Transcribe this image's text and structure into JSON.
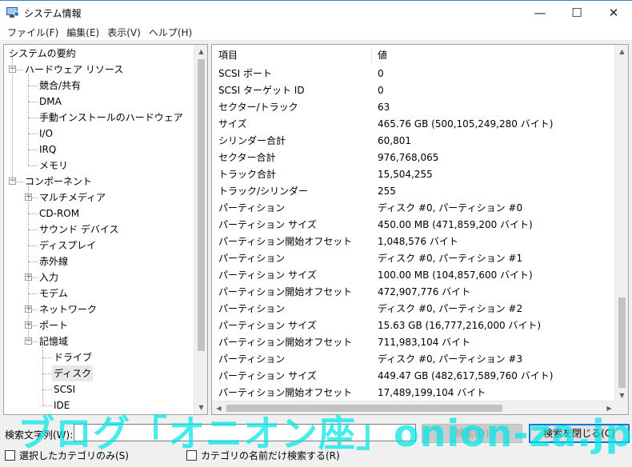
{
  "window": {
    "title": "システム情報",
    "controls": {
      "minimize": "—",
      "maximize": "☐",
      "close": "✕"
    }
  },
  "menu": [
    "ファイル(F)",
    "編集(E)",
    "表示(V)",
    "ヘルプ(H)"
  ],
  "tree": [
    {
      "label": "システムの要約",
      "level": 0,
      "expander": ""
    },
    {
      "label": "ハードウェア リソース",
      "level": 1,
      "expander": "−"
    },
    {
      "label": "競合/共有",
      "level": 2,
      "expander": ""
    },
    {
      "label": "DMA",
      "level": 2,
      "expander": ""
    },
    {
      "label": "手動インストールのハードウェア",
      "level": 2,
      "expander": ""
    },
    {
      "label": "I/O",
      "level": 2,
      "expander": ""
    },
    {
      "label": "IRQ",
      "level": 2,
      "expander": ""
    },
    {
      "label": "メモリ",
      "level": 2,
      "expander": ""
    },
    {
      "label": "コンポーネント",
      "level": 1,
      "expander": "−"
    },
    {
      "label": "マルチメディア",
      "level": 2,
      "expander": "+"
    },
    {
      "label": "CD-ROM",
      "level": 2,
      "expander": ""
    },
    {
      "label": "サウンド デバイス",
      "level": 2,
      "expander": ""
    },
    {
      "label": "ディスプレイ",
      "level": 2,
      "expander": ""
    },
    {
      "label": "赤外線",
      "level": 2,
      "expander": ""
    },
    {
      "label": "入力",
      "level": 2,
      "expander": "+"
    },
    {
      "label": "モデム",
      "level": 2,
      "expander": ""
    },
    {
      "label": "ネットワーク",
      "level": 2,
      "expander": "+"
    },
    {
      "label": "ポート",
      "level": 2,
      "expander": "+"
    },
    {
      "label": "記憶域",
      "level": 2,
      "expander": "−"
    },
    {
      "label": "ドライブ",
      "level": 3,
      "expander": ""
    },
    {
      "label": "ディスク",
      "level": 3,
      "expander": "",
      "selected": true
    },
    {
      "label": "SCSI",
      "level": 3,
      "expander": ""
    },
    {
      "label": "IDE",
      "level": 3,
      "expander": ""
    }
  ],
  "table": {
    "headers": [
      "項目",
      "値"
    ],
    "rows": [
      [
        "SCSI ポート",
        "0"
      ],
      [
        "SCSI ターゲット ID",
        "0"
      ],
      [
        "セクター/トラック",
        "63"
      ],
      [
        "サイズ",
        "465.76 GB (500,105,249,280 バイト)"
      ],
      [
        "シリンダー合計",
        "60,801"
      ],
      [
        "セクター合計",
        "976,768,065"
      ],
      [
        "トラック合計",
        "15,504,255"
      ],
      [
        "トラック/シリンダー",
        "255"
      ],
      [
        "パーティション",
        "ディスク #0, パーティション #0"
      ],
      [
        "パーティション サイズ",
        "450.00 MB (471,859,200 バイト)"
      ],
      [
        "パーティション開始オフセット",
        "1,048,576 バイト"
      ],
      [
        "パーティション",
        "ディスク #0, パーティション #1"
      ],
      [
        "パーティション サイズ",
        "100.00 MB (104,857,600 バイト)"
      ],
      [
        "パーティション開始オフセット",
        "472,907,776 バイト"
      ],
      [
        "パーティション",
        "ディスク #0, パーティション #2"
      ],
      [
        "パーティション サイズ",
        "15.63 GB (16,777,216,000 バイト)"
      ],
      [
        "パーティション開始オフセット",
        "711,983,104 バイト"
      ],
      [
        "パーティション",
        "ディスク #0, パーティション #3"
      ],
      [
        "パーティション サイズ",
        "449.47 GB (482,617,589,760 バイト)"
      ],
      [
        "パーティション開始オフセット",
        "17,489,199,104 バイト"
      ]
    ]
  },
  "search": {
    "label": "検索文字列(W):",
    "value": "",
    "find_button": "検索(D)",
    "close_button": "検索を閉じる(C)"
  },
  "checkboxes": {
    "selected_only": "選択したカテゴリのみ(S)",
    "category_names": "カテゴリの名前だけ検索する(R)"
  },
  "watermark": "ブログ「オニオン座」onion-za.jp",
  "scroll": {
    "arrow_up": "▲",
    "arrow_down": "▼",
    "arrow_left": "◀",
    "arrow_right": "▶"
  }
}
